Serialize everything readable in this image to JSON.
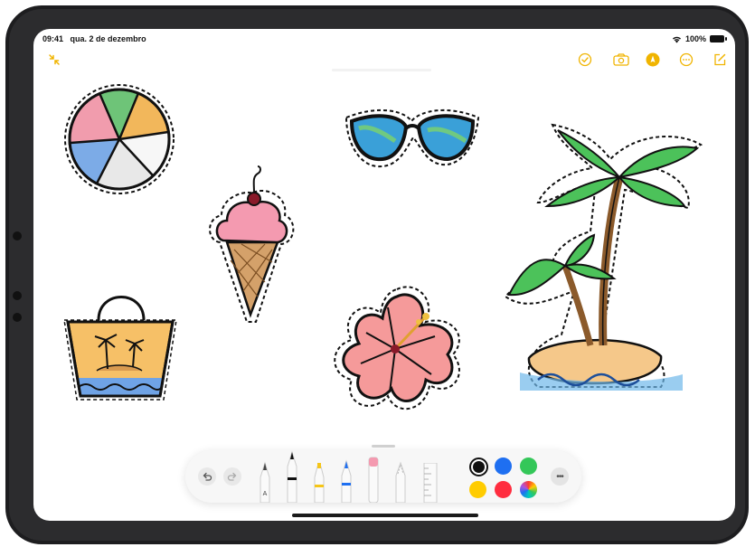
{
  "status": {
    "time": "09:41",
    "date": "qua. 2 de dezembro",
    "battery": "100%",
    "wifi_icon": "wifi-icon"
  },
  "top_toolbar": {
    "icons": [
      "collapse-icon",
      "checklist-icon",
      "camera-icon",
      "markup-icon",
      "more-icon",
      "compose-icon"
    ],
    "accent": "#f0b400"
  },
  "stickers": [
    "beach-ball",
    "ice-cream-cone",
    "sunglasses",
    "hibiscus-flower",
    "beach-bag",
    "palm-tree-island"
  ],
  "markup_toolbar": {
    "tools": [
      "monoline-pen",
      "pen",
      "highlighter",
      "pencil",
      "eraser",
      "lasso",
      "ruler"
    ],
    "tool_letter": "A",
    "selected_color": "#111111",
    "colors": [
      "#111111",
      "#1e6ff1",
      "#34c759",
      "#ffcc00",
      "#ff2d3f",
      "color-picker"
    ]
  }
}
